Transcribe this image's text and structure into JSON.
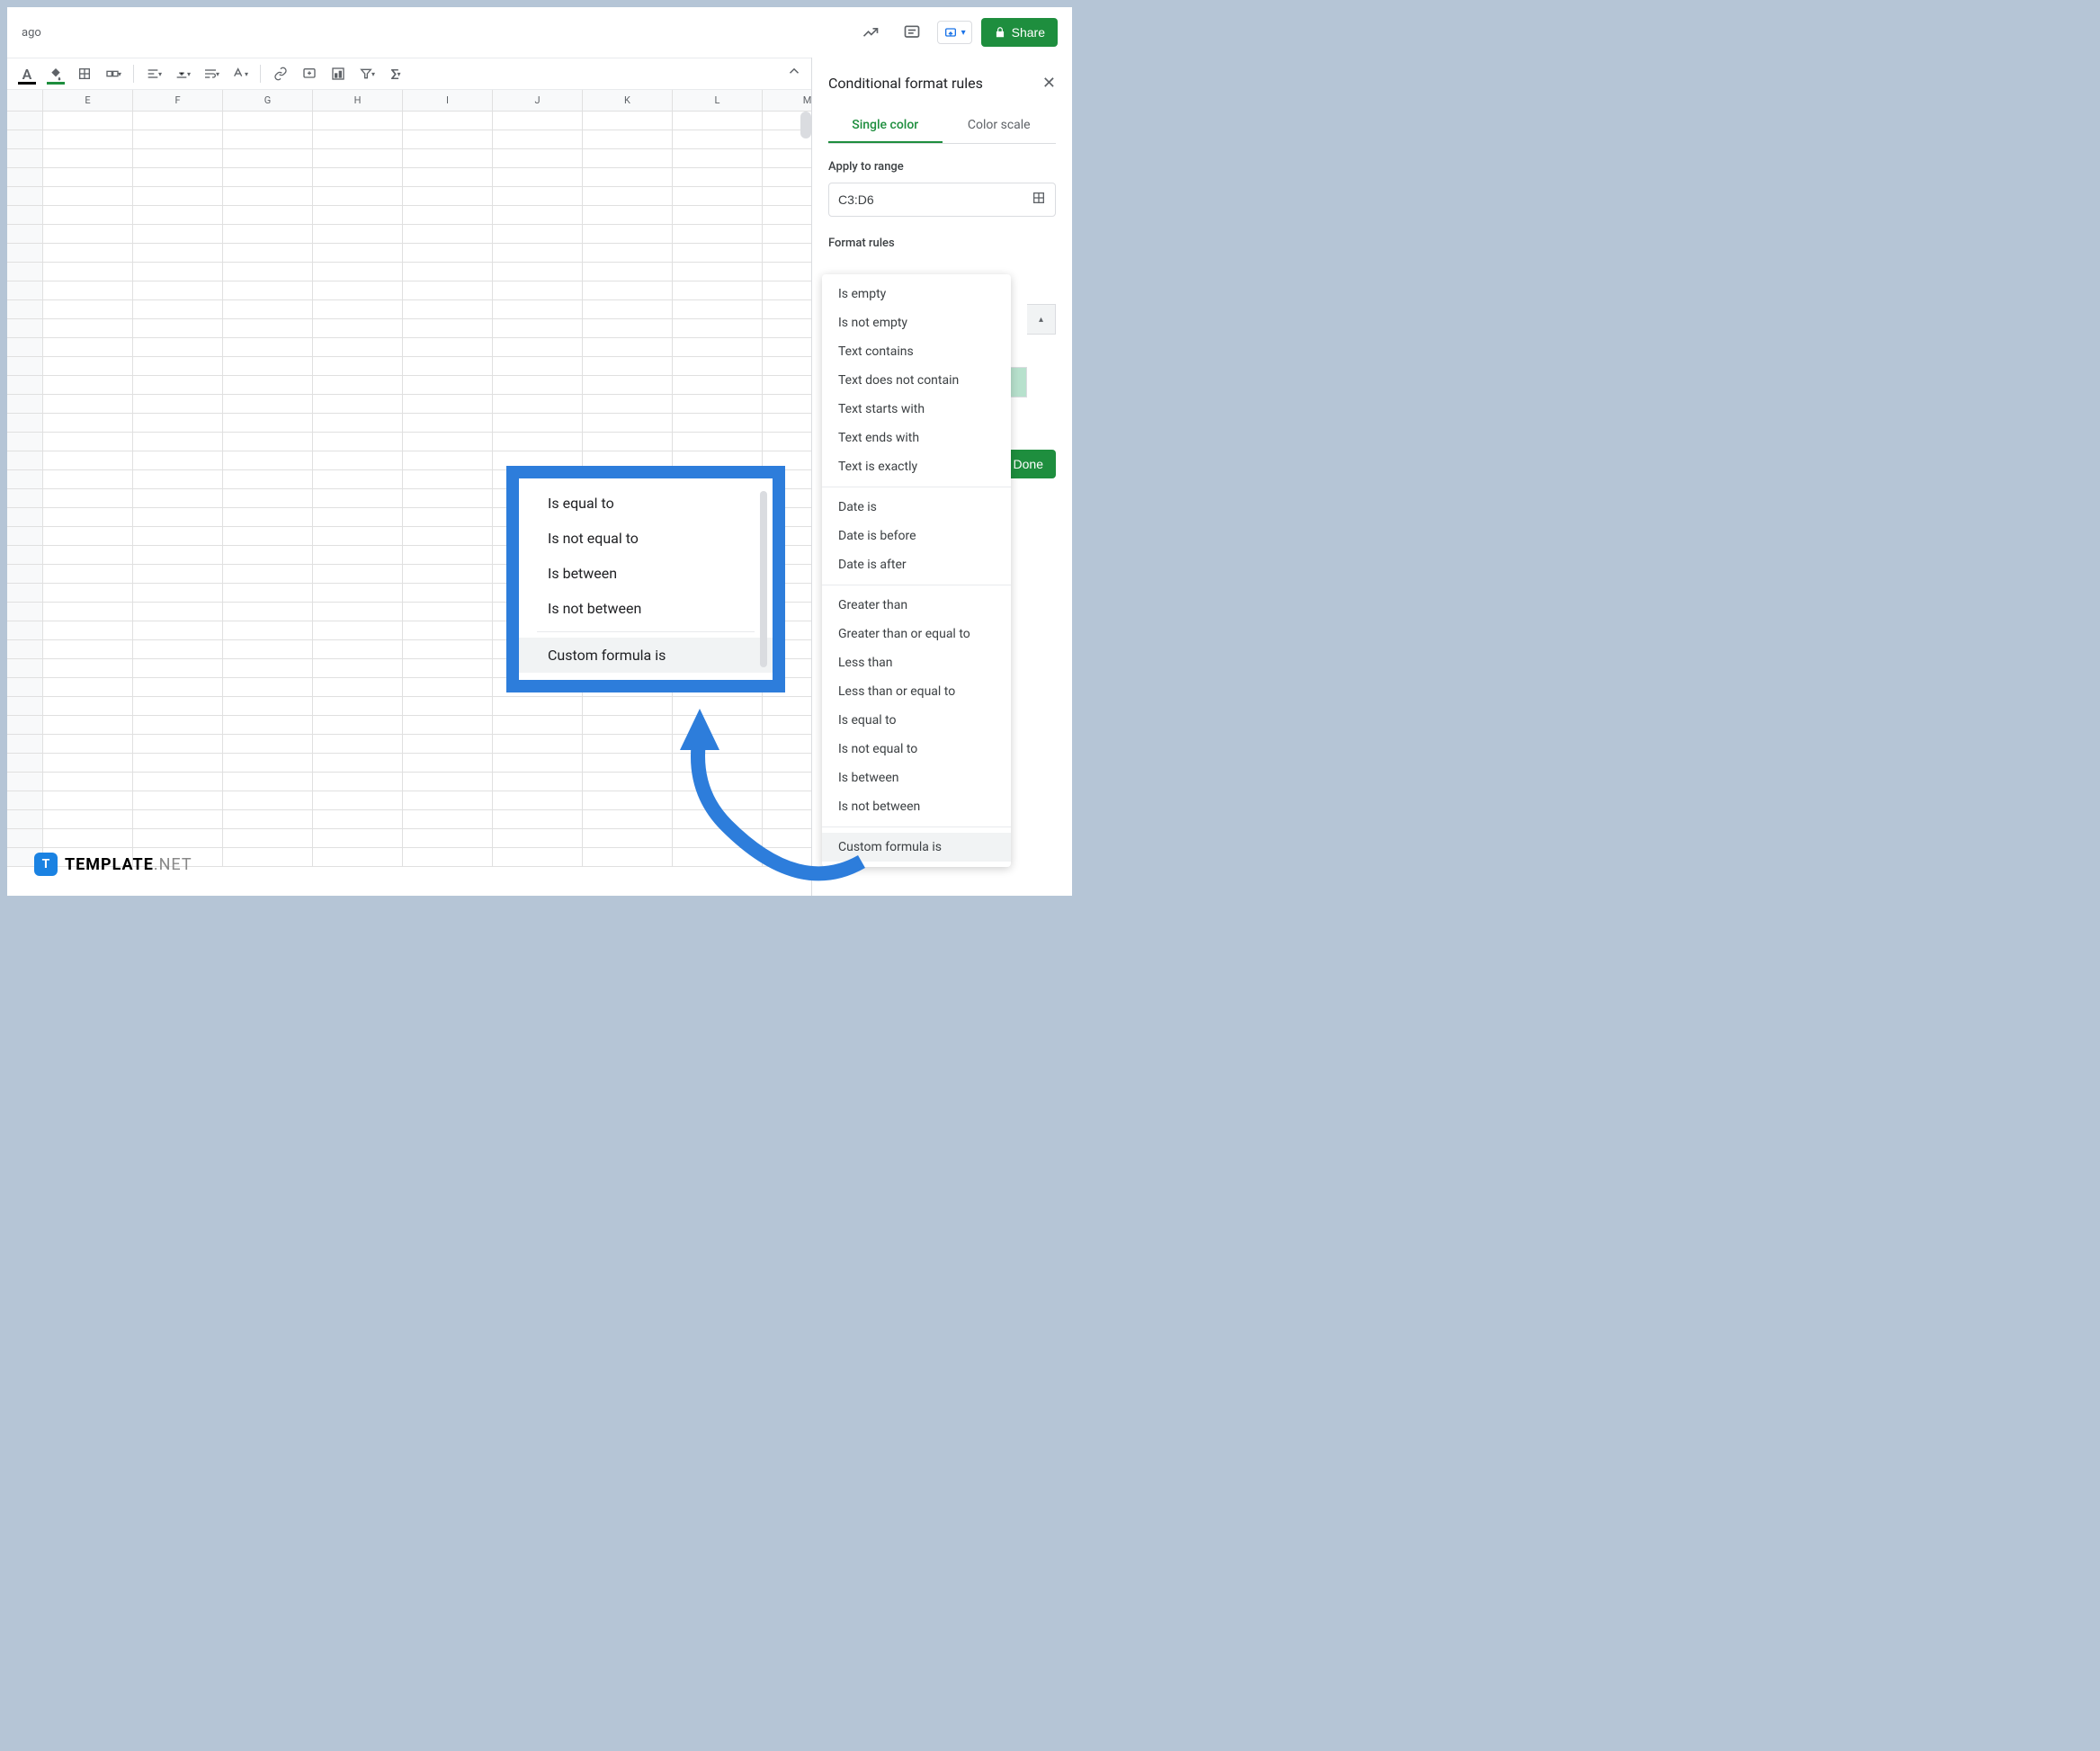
{
  "topbar": {
    "ago": "ago",
    "share": "Share"
  },
  "columns": [
    "E",
    "F",
    "G",
    "H",
    "I",
    "J",
    "K",
    "L",
    "M"
  ],
  "panel": {
    "title": "Conditional format rules",
    "tab_single": "Single color",
    "tab_scale": "Color scale",
    "apply_label": "Apply to range",
    "range_value": "C3:D6",
    "rules_label": "Format rules",
    "done": "Done"
  },
  "rules": {
    "group1": [
      "Is empty",
      "Is not empty",
      "Text contains",
      "Text does not contain",
      "Text starts with",
      "Text ends with",
      "Text is exactly"
    ],
    "group2": [
      "Date is",
      "Date is before",
      "Date is after"
    ],
    "group3": [
      "Greater than",
      "Greater than or equal to",
      "Less than",
      "Less than or equal to",
      "Is equal to",
      "Is not equal to",
      "Is between",
      "Is not between"
    ],
    "group4": [
      "Custom formula is"
    ]
  },
  "callout": {
    "items": [
      "Is equal to",
      "Is not equal to",
      "Is between",
      "Is not between"
    ],
    "highlight": "Custom formula is"
  },
  "watermark": {
    "badge": "T",
    "name": "TEMPLATE",
    "suffix": ".NET"
  }
}
